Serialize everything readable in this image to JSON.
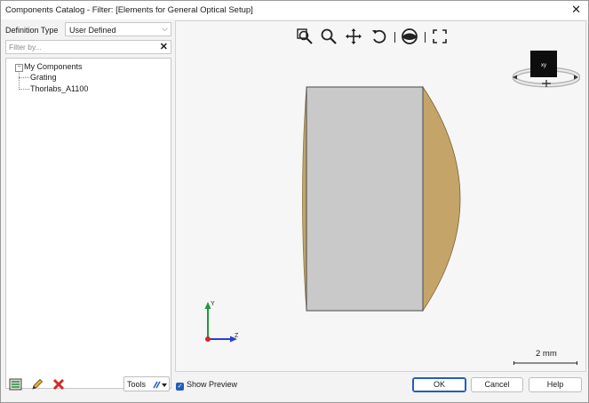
{
  "window": {
    "title": "Components Catalog - Filter: [Elements for General Optical Setup]"
  },
  "definition": {
    "label": "Definition Type",
    "value": "User Defined"
  },
  "filter": {
    "placeholder": "Filter by...",
    "value": ""
  },
  "tree": {
    "root": "My Components",
    "items": [
      "Grating",
      "Thorlabs_A1100"
    ]
  },
  "viewer": {
    "toolbar": [
      "zoom-extents-icon",
      "zoom-icon",
      "pan-icon",
      "rotate-icon",
      "view-mode-icon",
      "fullscreen-icon"
    ],
    "cube_label": "xy",
    "axes": {
      "y": "Y",
      "z": "Z"
    },
    "scale": "2 mm",
    "colors": {
      "lens_body": "#c9c9c9",
      "lens_curve": "#c4a468",
      "x_axis": "#2a3fd0",
      "y_axis": "#1f9a3a"
    }
  },
  "footer": {
    "tools_label": "Tools",
    "preview_label": "Show Preview",
    "preview_checked": true,
    "ok": "OK",
    "cancel": "Cancel",
    "help": "Help"
  }
}
